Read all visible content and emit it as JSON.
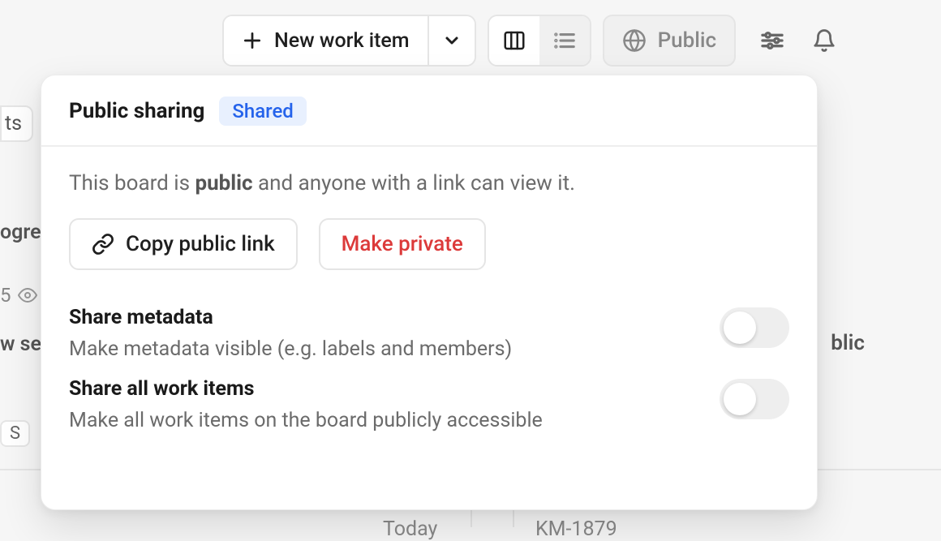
{
  "toolbar": {
    "new_work_item_label": "New work item",
    "public_label": "Public"
  },
  "popover": {
    "title": "Public sharing",
    "badge": "Shared",
    "desc_prefix": "This board is ",
    "desc_bold": "public",
    "desc_suffix": " and anyone with a link can view it.",
    "copy_link_label": "Copy public link",
    "make_private_label": "Make private",
    "settings": [
      {
        "title": "Share metadata",
        "desc": "Make metadata visible (e.g. labels and members)",
        "enabled": false
      },
      {
        "title": "Share all work items",
        "desc": "Make all work items on the board publicly accessible",
        "enabled": false
      }
    ]
  },
  "background": {
    "ts": "ts",
    "ogre": "ogre",
    "five": "5",
    "w_se": "w se",
    "s_badge": "S",
    "blic": "blic",
    "today": "Today",
    "km": "KM-1879"
  }
}
